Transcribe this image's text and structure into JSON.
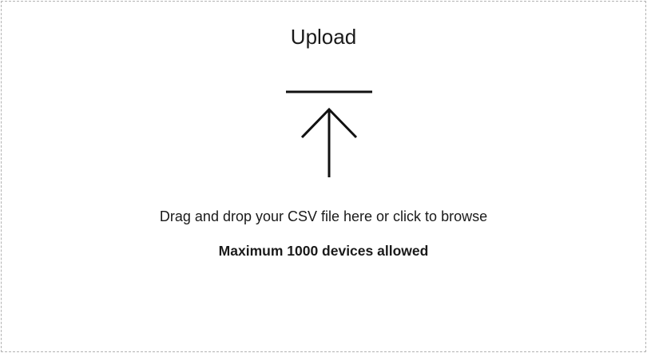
{
  "upload": {
    "title": "Upload",
    "icon": "upload-arrow-icon",
    "instruction": "Drag and drop your CSV file here or click to browse",
    "limit_note": "Maximum 1000 devices allowed"
  }
}
